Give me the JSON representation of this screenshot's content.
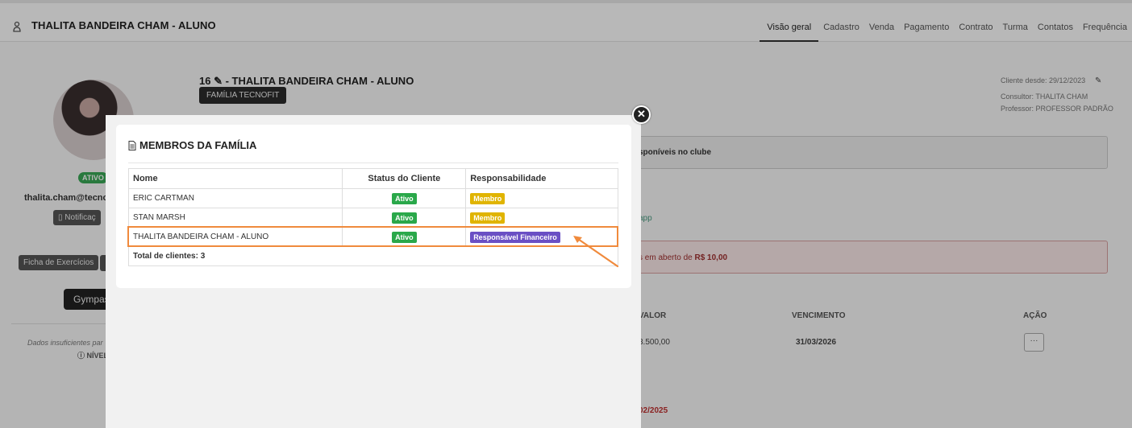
{
  "header": {
    "title": "THALITA BANDEIRA CHAM - ALUNO",
    "tabs": [
      "Visão geral",
      "Cadastro",
      "Venda",
      "Pagamento",
      "Contrato",
      "Turma",
      "Contatos",
      "Frequência"
    ]
  },
  "profile": {
    "status": "ATIVO",
    "email": "thalita.cham@tecno",
    "notify_label": "Notificaç",
    "exercise_label": "Ficha de Exercícios",
    "gympass_label": "Gympas",
    "insufficient_text": "Dados insuficientes par",
    "level_text": "NÍVEL"
  },
  "client": {
    "name": "16 ✎ - THALITA BANDEIRA CHAM - ALUNO",
    "family_badge": "FAMÍLIA TECNOFIT",
    "since": "Cliente desde: 29/12/2023",
    "consultant": "Consultor: THALITA CHAM",
    "professor": "Professor: PROFESSOR PADRÃO"
  },
  "background": {
    "available_text": "sponíveis no clube",
    "app_text": "app",
    "open_text_prefix": "s em aberto de ",
    "open_amount": "R$ 10,00",
    "col_valor": "VALOR",
    "col_venc": "VENCIMENTO",
    "col_acao": "AÇÃO",
    "row_valor": "3.500,00",
    "row_venc": "31/03/2026",
    "action_glyph": "···",
    "red_date": "02/2025"
  },
  "modal": {
    "title": "MEMBROS DA FAMÍLIA",
    "close_glyph": "✕",
    "columns": [
      "Nome",
      "Status do Cliente",
      "Responsabilidade"
    ],
    "rows": [
      {
        "name": "ERIC CARTMAN",
        "status": "Ativo",
        "role": "Membro"
      },
      {
        "name": "STAN MARSH",
        "status": "Ativo",
        "role": "Membro"
      },
      {
        "name": "THALITA BANDEIRA CHAM - ALUNO",
        "status": "Ativo",
        "role": "Responsável Financeiro"
      }
    ],
    "total": "Total de clientes: 3"
  },
  "colors": {
    "accent_highlight": "#f08a3c",
    "active_green": "#2aa84a",
    "member_yellow": "#e0b400",
    "financial_purple": "#6a4fc4"
  }
}
